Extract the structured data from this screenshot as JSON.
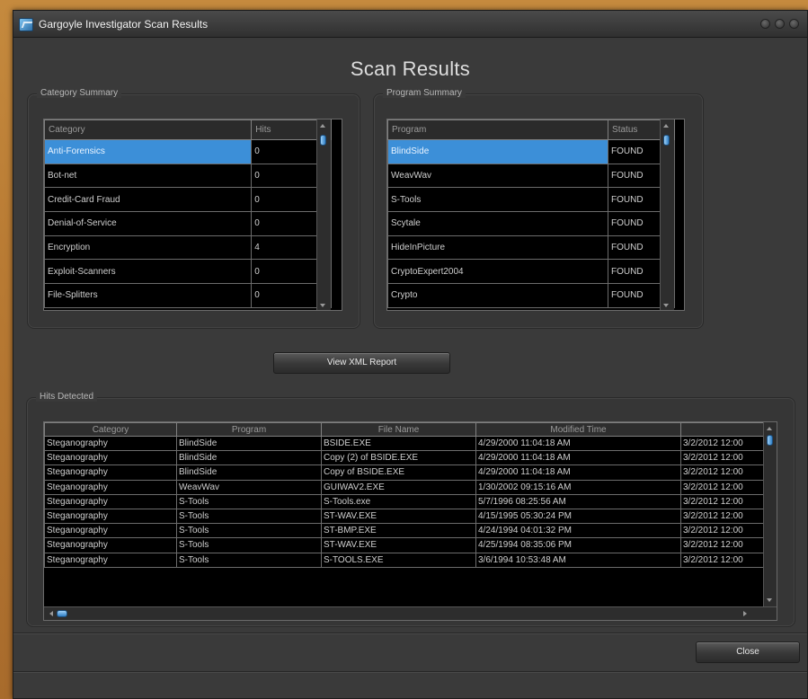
{
  "window": {
    "title": "Gargoyle Investigator Scan Results"
  },
  "page_title": "Scan Results",
  "category_summary": {
    "label": "Category Summary",
    "columns": [
      "Category",
      "Hits"
    ],
    "rows": [
      [
        "Anti-Forensics",
        "0"
      ],
      [
        "Bot-net",
        "0"
      ],
      [
        "Credit-Card Fraud",
        "0"
      ],
      [
        "Denial-of-Service",
        "0"
      ],
      [
        "Encryption",
        "4"
      ],
      [
        "Exploit-Scanners",
        "0"
      ],
      [
        "File-Splitters",
        "0"
      ]
    ]
  },
  "program_summary": {
    "label": "Program Summary",
    "columns": [
      "Program",
      "Status"
    ],
    "rows": [
      [
        "BlindSide",
        "FOUND"
      ],
      [
        "WeavWav",
        "FOUND"
      ],
      [
        "S-Tools",
        "FOUND"
      ],
      [
        "Scytale",
        "FOUND"
      ],
      [
        "HideInPicture",
        "FOUND"
      ],
      [
        "CryptoExpert2004",
        "FOUND"
      ],
      [
        "Crypto",
        "FOUND"
      ]
    ]
  },
  "view_xml_button": "View XML Report",
  "hits_detected": {
    "label": "Hits Detected",
    "columns": [
      "Category",
      "Program",
      "File Name",
      "Modified Time",
      ""
    ],
    "rows": [
      [
        "Steganography",
        "BlindSide",
        "BSIDE.EXE",
        "4/29/2000 11:04:18 AM",
        "3/2/2012 12:00"
      ],
      [
        "Steganography",
        "BlindSide",
        "Copy (2) of BSIDE.EXE",
        "4/29/2000 11:04:18 AM",
        "3/2/2012 12:00"
      ],
      [
        "Steganography",
        "BlindSide",
        "Copy of BSIDE.EXE",
        "4/29/2000 11:04:18 AM",
        "3/2/2012 12:00"
      ],
      [
        "Steganography",
        "WeavWav",
        "GUIWAV2.EXE",
        "1/30/2002 09:15:16 AM",
        "3/2/2012 12:00"
      ],
      [
        "Steganography",
        "S-Tools",
        "S-Tools.exe",
        "5/7/1996 08:25:56 AM",
        "3/2/2012 12:00"
      ],
      [
        "Steganography",
        "S-Tools",
        "ST-WAV.EXE",
        "4/15/1995 05:30:24 PM",
        "3/2/2012 12:00"
      ],
      [
        "Steganography",
        "S-Tools",
        "ST-BMP.EXE",
        "4/24/1994 04:01:32 PM",
        "3/2/2012 12:00"
      ],
      [
        "Steganography",
        "S-Tools",
        "ST-WAV.EXE",
        "4/25/1994 08:35:06 PM",
        "3/2/2012 12:00"
      ],
      [
        "Steganography",
        "S-Tools",
        "S-TOOLS.EXE",
        "3/6/1994 10:53:48 AM",
        "3/2/2012 12:00"
      ]
    ]
  },
  "close_button": "Close"
}
